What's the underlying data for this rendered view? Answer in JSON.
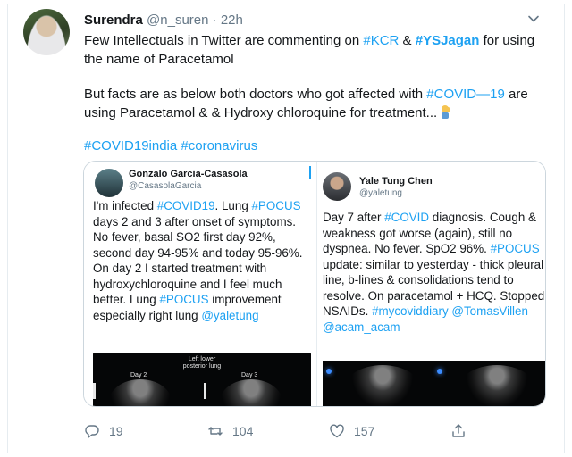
{
  "tweet": {
    "author_name": "Surendra",
    "author_handle": "@n_suren",
    "separator": "·",
    "time": "22h",
    "para1": [
      {
        "t": "Few Intellectuals in Twitter are commenting on ",
        "k": "text"
      },
      {
        "t": "#KCR",
        "k": "tag"
      },
      {
        "t": " & ",
        "k": "text"
      },
      {
        "t": "#YSJagan",
        "k": "tagb"
      },
      {
        "t": " for using the name of Paracetamol",
        "k": "text"
      }
    ],
    "para2": [
      {
        "t": "But facts are as below both doctors who got affected with ",
        "k": "text"
      },
      {
        "t": "#COVID—19",
        "k": "tag"
      },
      {
        "t": " are using Paracetamol & & Hydroxy chloroquine for treatment...",
        "k": "text"
      }
    ],
    "para3": [
      {
        "t": "#COVID19india",
        "k": "tag"
      },
      {
        "t": " ",
        "k": "text"
      },
      {
        "t": "#coronavirus",
        "k": "tag"
      }
    ],
    "reply_count": "19",
    "retweet_count": "104",
    "like_count": "157"
  },
  "embedded": [
    {
      "name": "Gonzalo Garcia-Casasola",
      "handle": "@CasasolaGarcia",
      "segments": [
        {
          "t": "I'm infected ",
          "k": "text"
        },
        {
          "t": "#COVID19",
          "k": "tag"
        },
        {
          "t": ".  Lung ",
          "k": "text"
        },
        {
          "t": "#POCUS",
          "k": "tag"
        },
        {
          "t": "  days 2 and 3 after onset of symptoms. No fever, basal SO2 first day 92%, second day 94-95% and today 95-96%. On day 2 I started treatment with hydroxychloroquine and I feel much better. Lung ",
          "k": "text"
        },
        {
          "t": "#POCUS",
          "k": "tag"
        },
        {
          "t": " improvement especially right lung ",
          "k": "text"
        },
        {
          "t": "@yaletung",
          "k": "tag"
        }
      ],
      "image_labels": {
        "title": "Left lower\nposterior lung",
        "left": "Day 2",
        "right": "Day 3"
      }
    },
    {
      "name": "Yale Tung Chen",
      "handle": "@yaletung",
      "segments": [
        {
          "t": "Day 7 after ",
          "k": "text"
        },
        {
          "t": "#COVID",
          "k": "tag"
        },
        {
          "t": " diagnosis. Cough & weakness got worse (again), still no dyspnea. No fever. SpO2 96%. ",
          "k": "text"
        },
        {
          "t": "#POCUS",
          "k": "tag"
        },
        {
          "t": " update: similar to yesterday - thick pleural line, b-lines & consolidations tend to resolve. On paracetamol + HCQ. Stopped NSAIDs. ",
          "k": "text"
        },
        {
          "t": "#mycoviddiary",
          "k": "tag"
        },
        {
          "t": " ",
          "k": "text"
        },
        {
          "t": "@TomasVillen",
          "k": "tag"
        },
        {
          "t": " ",
          "k": "text"
        },
        {
          "t": "@acam_acam",
          "k": "tag"
        }
      ]
    }
  ],
  "colors": {
    "link": "#1da1f2",
    "muted": "#657786",
    "text": "#14171a",
    "border": "#ccd6dd"
  },
  "icons": {
    "reply": "reply-icon",
    "retweet": "retweet-icon",
    "like": "heart-icon",
    "share": "share-icon",
    "more": "chevron-down-icon",
    "emoji": "man-facepalming-emoji"
  }
}
